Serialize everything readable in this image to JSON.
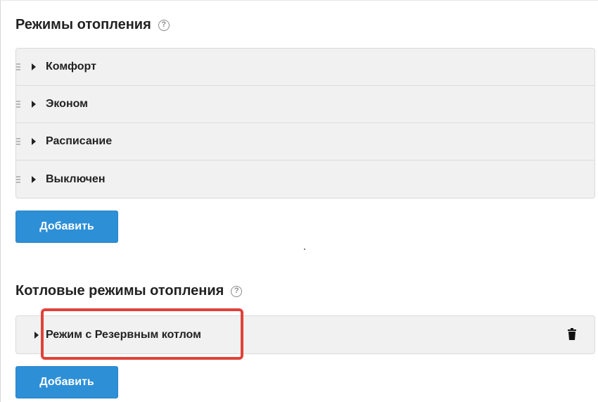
{
  "heating_modes": {
    "title": "Режимы отопления",
    "help_icon": "question-circle-icon",
    "items": [
      {
        "label": "Комфорт"
      },
      {
        "label": "Эконом"
      },
      {
        "label": "Расписание"
      },
      {
        "label": "Выключен"
      }
    ],
    "add_button": "Добавить"
  },
  "boiler_modes": {
    "title": "Котловые режимы отопления",
    "help_icon": "question-circle-icon",
    "items": [
      {
        "label": "Режим с Резервным котлом",
        "delete_icon": "trash-icon"
      }
    ],
    "add_button": "Добавить"
  },
  "colors": {
    "primary_button": "#2d8fd6",
    "highlight_border": "#e0423a",
    "list_background": "#f1f1f1"
  }
}
